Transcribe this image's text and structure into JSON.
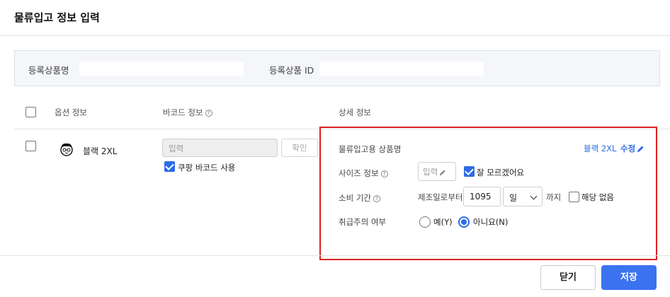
{
  "dialog": {
    "title": "물류입고 정보 입력"
  },
  "product": {
    "name_label": "등록상품명",
    "name_value": "",
    "id_label": "등록상품 ID",
    "id_value": ""
  },
  "columns": {
    "option": "옵션 정보",
    "barcode": "바코드 정보",
    "detail": "상세 정보"
  },
  "row": {
    "selected": false,
    "option_name": "블랙 2XL",
    "barcode": {
      "placeholder": "입력",
      "confirm_label": "확인",
      "use_coupang_barcode_label": "쿠팡 바코드 사용",
      "use_coupang_barcode": true
    },
    "detail": {
      "product_name_label": "물류입고용 상품명",
      "product_name_value": "블랙 2XL",
      "edit_label": "수정",
      "size_label": "사이즈 정보",
      "size_placeholder": "입력",
      "size_unknown_label": "잘 모르겠어요",
      "size_unknown": true,
      "expiry_label": "소비 기간",
      "expiry_from_label": "제조일로부터",
      "expiry_value": "1095",
      "expiry_unit": "일",
      "expiry_until_label": "까지",
      "not_applicable_label": "해당 없음",
      "not_applicable": false,
      "fragile_label": "취급주의 여부",
      "fragile_yes_label": "예(Y)",
      "fragile_no_label": "아니요(N)",
      "fragile": "no"
    }
  },
  "footer": {
    "close_label": "닫기",
    "save_label": "저장"
  },
  "colors": {
    "accent": "#2d6be6",
    "highlight_border": "#d92222",
    "save_button": "#3b72ef"
  },
  "icons": [
    "help-icon",
    "pencil-icon",
    "check-icon",
    "chevron-down-icon",
    "avatar-icon"
  ]
}
